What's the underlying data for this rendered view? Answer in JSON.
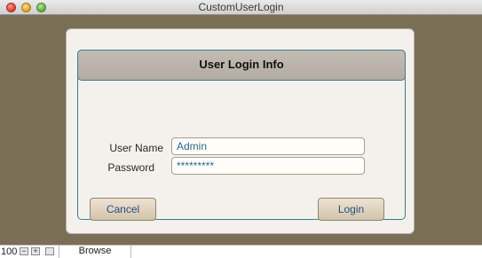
{
  "window": {
    "title": "CustomUserLogin"
  },
  "form": {
    "header": "User Login Info",
    "username_label": "User Name",
    "username_value": "Admin",
    "password_label": "Password",
    "password_value": "*********",
    "cancel_label": "Cancel",
    "login_label": "Login"
  },
  "statusbar": {
    "zoom": "100",
    "mode": "Browse"
  },
  "colors": {
    "background": "#7b6e56",
    "accent": "#3f7d89",
    "header_bg": "#b8b1a8"
  }
}
